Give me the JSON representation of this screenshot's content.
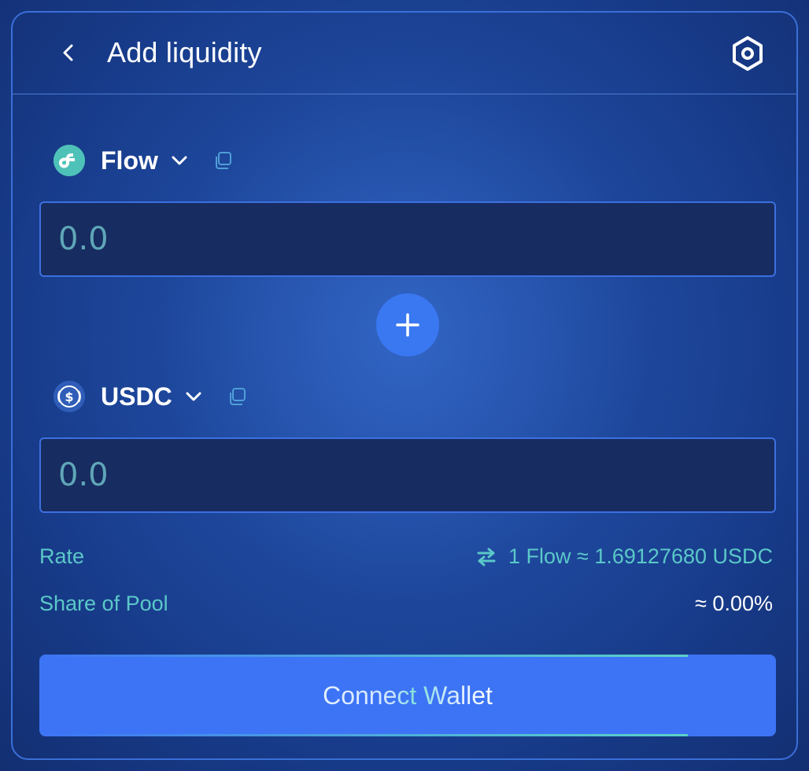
{
  "header": {
    "title": "Add liquidity",
    "back_icon": "chevron-left-icon",
    "settings_icon": "hexagon-settings-icon"
  },
  "token_a": {
    "symbol": "Flow",
    "icon": "flow-token-icon",
    "icon_color": "#4ec2b8",
    "amount_placeholder": "0.0"
  },
  "token_b": {
    "symbol": "USDC",
    "icon": "usdc-token-icon",
    "icon_color": "#2f5db8",
    "amount_placeholder": "0.0"
  },
  "info": {
    "rate_label": "Rate",
    "rate_value": "1 Flow ≈ 1.69127680 USDC",
    "share_label": "Share of Pool",
    "share_value": "≈ 0.00%"
  },
  "action": {
    "connect_label": "Connect Wallet"
  },
  "colors": {
    "accent": "#3d74f5",
    "teal": "#5bc8c8",
    "panel_border": "#3b6fd8",
    "input_bg": "#172c60"
  }
}
